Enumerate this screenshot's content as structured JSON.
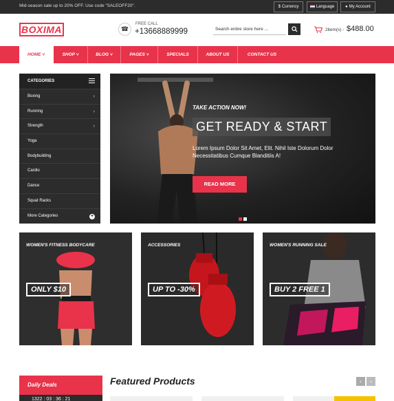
{
  "topbar": {
    "promo": "Mid-season sale up to 20% OFF. Use code \"SALEOFF20\".",
    "currency": "Currency",
    "language": "Language",
    "account": "My Account"
  },
  "header": {
    "logo": "BOXIMA",
    "free_call": "FREE CALL",
    "phone": "+13668889999",
    "search_placeholder": "Search entire store here ...",
    "cart_items": "2item(s) -",
    "cart_total": "$488.00"
  },
  "nav": {
    "items": [
      {
        "label": "HOME"
      },
      {
        "label": "SHOP"
      },
      {
        "label": "BLOG"
      },
      {
        "label": "PAGES"
      },
      {
        "label": "SPECIALS"
      },
      {
        "label": "ABOUT US"
      },
      {
        "label": "CONTACT US"
      }
    ]
  },
  "sidebar": {
    "title": "CATEGORIES",
    "items": [
      {
        "label": "Boxing"
      },
      {
        "label": "Running"
      },
      {
        "label": "Strength"
      },
      {
        "label": "Yoga"
      },
      {
        "label": "Bodybuilding"
      },
      {
        "label": "Cardio"
      },
      {
        "label": "Dance"
      },
      {
        "label": "Squat Racks"
      },
      {
        "label": "More Categories"
      }
    ]
  },
  "hero": {
    "tagline": "TAKE ACTION NOW!",
    "headline": "GET READY & START",
    "description": "Lorem Ipsum Dolor Sit Amet, Elit. Nihil Iste Dolorum Dolor Necessitatibus Cumque Blanditiis A!",
    "button": "READ MORE"
  },
  "banners": [
    {
      "title": "WOMEN'S FITNESS BODYCARE",
      "offer": "ONLY $10"
    },
    {
      "title": "ACCESSORIES",
      "offer": "UP TO -30%"
    },
    {
      "title": "WOMEN'S RUNNING SALE",
      "offer": "BUY 2 FREE 1"
    }
  ],
  "daily_deals": {
    "title": "Daily Deals",
    "timer": "1322 : 03 : 36 : 21"
  },
  "featured": {
    "title": "Featured Products"
  },
  "colors": {
    "accent": "#e8334a",
    "dark": "#2c2c2c"
  }
}
